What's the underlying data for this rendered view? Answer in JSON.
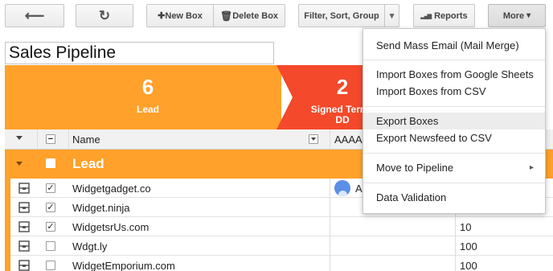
{
  "toolbar": {
    "back_glyph": "⟵",
    "refresh_glyph": "↻",
    "new_box_glyph": "✚",
    "new_box": "New Box",
    "delete_box_glyph": "🗑",
    "delete_box": "Delete Box",
    "filter": "Filter, Sort, Group",
    "filter_caret": "▾",
    "reports_glyph": "▂▄▆",
    "reports": "Reports",
    "more": "More",
    "more_caret": "▾"
  },
  "pipeline": {
    "name": "Sales Pipeline"
  },
  "stages": [
    {
      "count": "6",
      "label": "Lead",
      "color": "#ffa12a"
    },
    {
      "count": "2",
      "label": "Signed Terms",
      "label2": "DD",
      "color": "#f4492a"
    }
  ],
  "grid": {
    "name_header": "Name",
    "col_header_fragment": "AAAA",
    "group_label": "Lead",
    "rows": [
      {
        "checked": true,
        "check_glyph": "✓",
        "name": "Widgetgadget.co",
        "assignee_initial": "A",
        "value": ""
      },
      {
        "checked": true,
        "check_glyph": "✓",
        "name": "Widget.ninja",
        "assignee_initial": "",
        "value": ""
      },
      {
        "checked": true,
        "check_glyph": "✓",
        "name": "WidgetsrUs.com",
        "assignee_initial": "",
        "value": "10"
      },
      {
        "checked": false,
        "check_glyph": "",
        "name": "Wdgt.ly",
        "assignee_initial": "",
        "value": "100"
      },
      {
        "checked": false,
        "check_glyph": "",
        "name": "WidgetEmporium.com",
        "assignee_initial": "",
        "value": "100"
      }
    ]
  },
  "more_menu": {
    "items": [
      "Send Mass Email (Mail Merge)",
      "Import Boxes from Google Sheets",
      "Import Boxes from CSV",
      "Export Boxes",
      "Export Newsfeed to CSV",
      "Move to Pipeline",
      "Data Validation"
    ],
    "submenu_arrow": "▸",
    "highlighted": "Export Boxes"
  },
  "colors": {
    "lead": "#ffa12a",
    "signed": "#f4492a",
    "avatar": "#5b8fe8"
  }
}
